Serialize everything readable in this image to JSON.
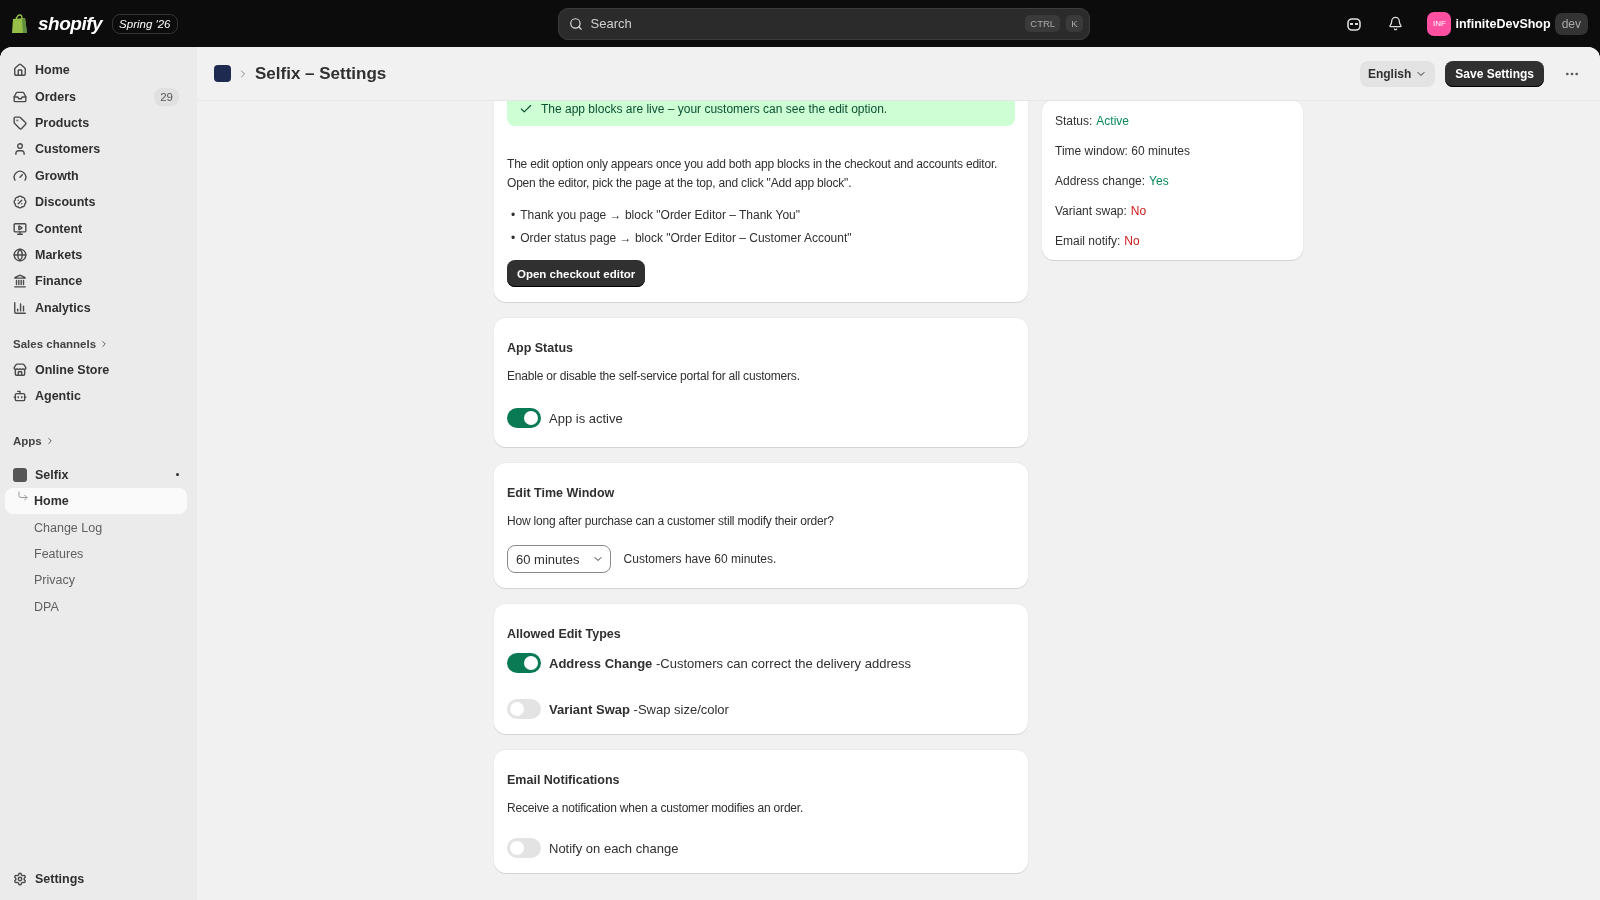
{
  "topbar": {
    "brand": "shopify",
    "release": "Spring '26",
    "search": {
      "placeholder": "Search",
      "keys": [
        "CTRL",
        "K"
      ]
    },
    "account": {
      "initials": "INF",
      "shop": "infiniteDevShop",
      "badge": "dev"
    }
  },
  "sidebar": {
    "items": [
      {
        "kind": "home",
        "label": "Home"
      },
      {
        "kind": "orders",
        "label": "Orders",
        "count": "29"
      },
      {
        "kind": "products",
        "label": "Products"
      },
      {
        "kind": "customers",
        "label": "Customers"
      },
      {
        "kind": "growth",
        "label": "Growth"
      },
      {
        "kind": "discounts",
        "label": "Discounts"
      },
      {
        "kind": "content",
        "label": "Content"
      },
      {
        "kind": "markets",
        "label": "Markets"
      },
      {
        "kind": "finance",
        "label": "Finance"
      },
      {
        "kind": "analytics",
        "label": "Analytics"
      }
    ],
    "channels": {
      "heading": "Sales channels",
      "items": [
        {
          "kind": "store",
          "label": "Online Store"
        },
        {
          "kind": "agentic",
          "label": "Agentic"
        }
      ]
    },
    "apps": {
      "heading": "Apps",
      "app": {
        "label": "Selfix",
        "pages": [
          {
            "label": "Home",
            "selected": true
          },
          {
            "label": "Change Log",
            "selected": false
          },
          {
            "label": "Features",
            "selected": false
          },
          {
            "label": "Privacy",
            "selected": false
          },
          {
            "label": "DPA",
            "selected": false
          }
        ]
      }
    },
    "settings": "Settings"
  },
  "header": {
    "title": "Selfix – Settings",
    "language": "English",
    "save": "Save Settings"
  },
  "setup": {
    "banner": "The app blocks are live – your customers can see the edit option.",
    "lines": [
      "The edit option only appears once you add both app blocks in the checkout and accounts editor.",
      "Open the editor, pick the page at the top, and click \"Add app block\"."
    ],
    "steps": [
      {
        "marker": "•",
        "text": "Thank you page → block \"Order Editor – Thank You\""
      },
      {
        "marker": "•",
        "text": "Order status page → block \"Order Editor – Customer Account\""
      }
    ],
    "button": "Open checkout editor"
  },
  "status": {
    "title": "App Status",
    "description": "Enable or disable the self-service portal for all customers.",
    "toggle": {
      "label": "App is active",
      "on": true
    }
  },
  "time_window": {
    "title": "Edit Time Window",
    "description": "How long after purchase can a customer still modify their order?",
    "select": "60 minutes",
    "note": "Customers have 60 minutes."
  },
  "edit_types": {
    "title": "Allowed Edit Types",
    "options": [
      {
        "name": "Address Change",
        "detail": "-Customers can correct the delivery address",
        "on": true
      },
      {
        "name": "Variant Swap",
        "detail": "-Swap size/color",
        "on": false
      }
    ]
  },
  "email": {
    "title": "Email Notifications",
    "description": "Receive a notification when a customer modifies an order.",
    "toggle": {
      "label": "Notify on each change",
      "on": false
    }
  },
  "summary": [
    {
      "label": "Status:",
      "value": "Active",
      "color": "#0a8a5a"
    },
    {
      "label": "Time window: 60 minutes"
    },
    {
      "label": "Address change:",
      "value": "Yes",
      "color": "#0a8a5a"
    },
    {
      "label": "Variant swap:",
      "value": "No",
      "color": "#d11a1a"
    },
    {
      "label": "Email notify:",
      "value": "No",
      "color": "#d11a1a"
    }
  ]
}
